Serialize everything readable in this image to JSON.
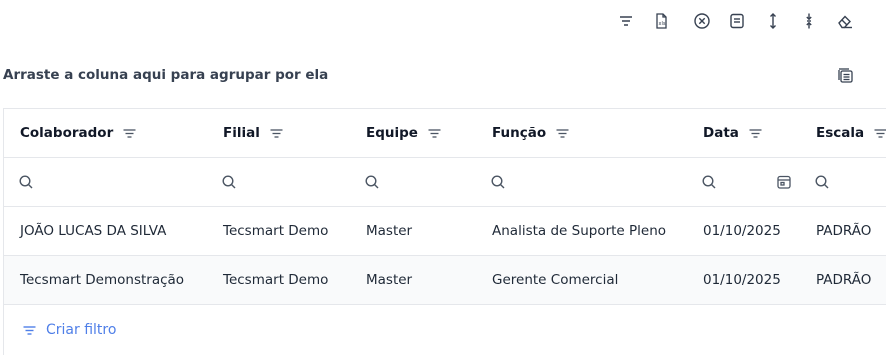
{
  "toolbar": {
    "icons": [
      "filter-icon",
      "export-excel-icon",
      "clear-icon",
      "summary-icon",
      "expand-rows-icon",
      "collapse-rows-icon",
      "eraser-icon"
    ]
  },
  "group_panel": {
    "label": "Arraste a coluna aqui para agrupar por ela"
  },
  "columns": [
    {
      "key": "colaborador",
      "label": "Colaborador"
    },
    {
      "key": "filial",
      "label": "Filial"
    },
    {
      "key": "equipe",
      "label": "Equipe"
    },
    {
      "key": "funcao",
      "label": "Função"
    },
    {
      "key": "data",
      "label": "Data"
    },
    {
      "key": "escala",
      "label": "Escala"
    }
  ],
  "rows": [
    {
      "colaborador": "JOÃO LUCAS DA SILVA",
      "filial": "Tecsmart Demo",
      "equipe": "Master",
      "funcao": "Analista de Suporte Pleno",
      "data": "01/10/2025",
      "escala": "PADRÃO"
    },
    {
      "colaborador": "Tecsmart Demonstração",
      "filial": "Tecsmart Demo",
      "equipe": "Master",
      "funcao": "Gerente Comercial",
      "data": "01/10/2025",
      "escala": "PADRÃO"
    }
  ],
  "footer": {
    "create_filter_label": "Criar filtro"
  },
  "colors": {
    "accent": "#4f7fe8",
    "border": "#e5e7eb",
    "text": "#1f2937"
  }
}
